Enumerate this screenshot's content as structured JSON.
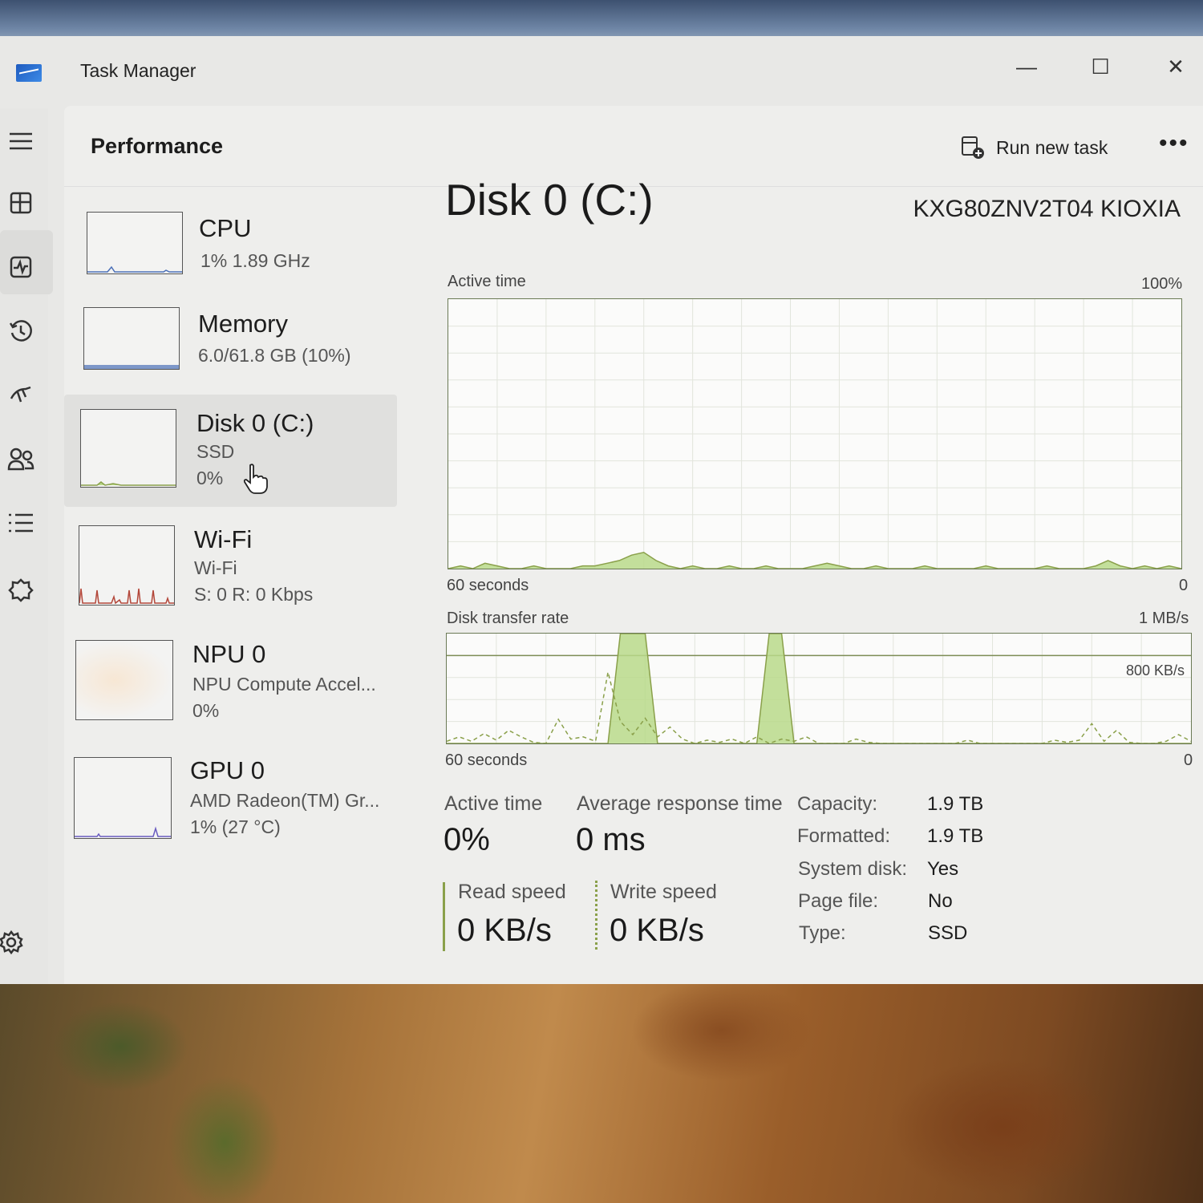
{
  "window": {
    "title": "Task Manager",
    "minimize_glyph": "—",
    "maximize_glyph": "☐",
    "close_glyph": "✕"
  },
  "nav": {
    "icons": [
      "hamburger-icon",
      "processes-icon",
      "performance-icon",
      "app-history-icon",
      "startup-icon",
      "users-icon",
      "details-icon",
      "services-icon",
      "settings-icon"
    ]
  },
  "header": {
    "page_title": "Performance",
    "run_new_task": "Run new task",
    "more": "•••"
  },
  "sidebar": {
    "items": [
      {
        "name": "CPU",
        "sub1": "1%  1.89 GHz",
        "sub2": ""
      },
      {
        "name": "Memory",
        "sub1": "6.0/61.8 GB (10%)",
        "sub2": ""
      },
      {
        "name": "Disk 0 (C:)",
        "sub1": "SSD",
        "sub2": "0%"
      },
      {
        "name": "Wi-Fi",
        "sub1": "Wi-Fi",
        "sub2": "S: 0 R: 0 Kbps"
      },
      {
        "name": "NPU 0",
        "sub1": "NPU Compute Accel...",
        "sub2": "0%"
      },
      {
        "name": "GPU 0",
        "sub1": "AMD Radeon(TM) Gr...",
        "sub2": "1%  (27 °C)"
      }
    ]
  },
  "detail": {
    "title": "Disk 0 (C:)",
    "model": "KXG80ZNV2T04 KIOXIA",
    "active_time_label": "Active time",
    "active_time_max": "100%",
    "active_x_left": "60 seconds",
    "active_x_right": "0",
    "transfer_label": "Disk transfer rate",
    "transfer_max": "1 MB/s",
    "transfer_mid": "800 KB/s",
    "transfer_x_left": "60 seconds",
    "transfer_x_right": "0"
  },
  "stats": {
    "active_time_label": "Active time",
    "active_time_value": "0%",
    "avg_response_label": "Average response time",
    "avg_response_value": "0 ms",
    "read_label": "Read speed",
    "read_value": "0 KB/s",
    "write_label": "Write speed",
    "write_value": "0 KB/s"
  },
  "properties": [
    {
      "key": "Capacity:",
      "value": "1.9 TB"
    },
    {
      "key": "Formatted:",
      "value": "1.9 TB"
    },
    {
      "key": "System disk:",
      "value": "Yes"
    },
    {
      "key": "Page file:",
      "value": "No"
    },
    {
      "key": "Type:",
      "value": "SSD"
    }
  ],
  "colors": {
    "accent_green": "#8aa04a",
    "fill_green": "#b9d98a",
    "wifi_red": "#b3473a",
    "memory_blue": "#4a6fb8"
  },
  "chart_data": [
    {
      "type": "area",
      "title": "Active time",
      "ylim": [
        0,
        100
      ],
      "x_range_seconds": [
        60,
        0
      ],
      "values": [
        0,
        1,
        0,
        2,
        1,
        0,
        0,
        1,
        0,
        0,
        0,
        1,
        1,
        2,
        3,
        5,
        6,
        3,
        1,
        0,
        1,
        0,
        0,
        1,
        0,
        0,
        1,
        0,
        0,
        0,
        1,
        2,
        1,
        0,
        0,
        1,
        0,
        0,
        0,
        1,
        0,
        0,
        0,
        0,
        1,
        0,
        0,
        0,
        0,
        1,
        0,
        0,
        0,
        1,
        3,
        1,
        0,
        1,
        0,
        1,
        0
      ]
    },
    {
      "type": "area",
      "title": "Disk transfer rate",
      "ylim_kb_s": [
        0,
        1000
      ],
      "x_range_seconds": [
        60,
        0
      ],
      "read_values_kb_s": [
        0,
        0,
        0,
        0,
        0,
        0,
        0,
        0,
        0,
        0,
        0,
        0,
        0,
        0,
        1000,
        1000,
        1000,
        0,
        0,
        0,
        0,
        0,
        0,
        0,
        0,
        0,
        1000,
        1000,
        0,
        0,
        0,
        0,
        0,
        0,
        0,
        0,
        0,
        0,
        0,
        0,
        0,
        0,
        0,
        0,
        0,
        0,
        0,
        0,
        0,
        0,
        0,
        0,
        0,
        0,
        0,
        0,
        0,
        0,
        0,
        0,
        0
      ],
      "write_values_kb_s": [
        20,
        60,
        20,
        90,
        30,
        120,
        60,
        10,
        0,
        220,
        40,
        60,
        20,
        650,
        200,
        80,
        230,
        60,
        150,
        40,
        0,
        30,
        10,
        40,
        0,
        60,
        0,
        40,
        20,
        60,
        0,
        0,
        0,
        40,
        10,
        0,
        0,
        0,
        0,
        0,
        0,
        0,
        30,
        0,
        0,
        0,
        0,
        0,
        0,
        30,
        10,
        30,
        180,
        20,
        120,
        10,
        0,
        0,
        20,
        80,
        20
      ]
    }
  ]
}
